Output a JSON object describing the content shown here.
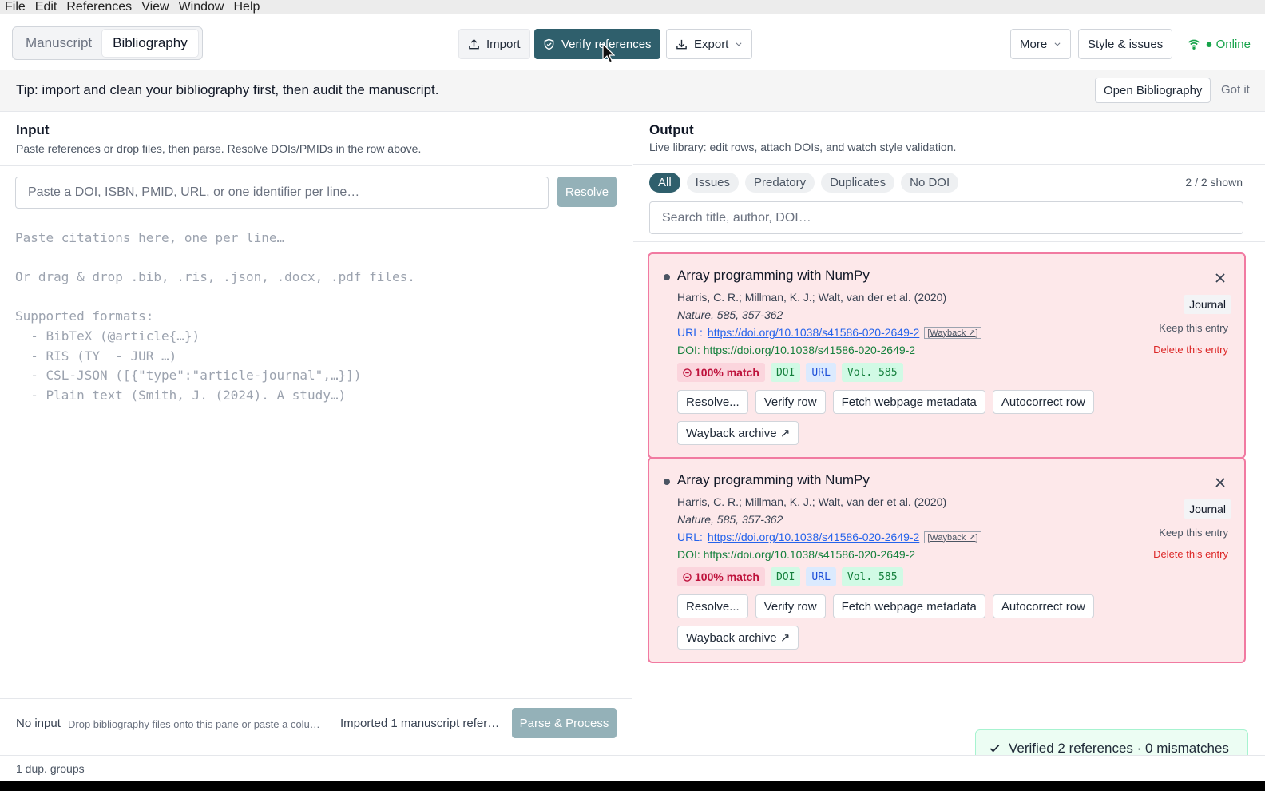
{
  "menubar": [
    "File",
    "Edit",
    "References",
    "View",
    "Window",
    "Help"
  ],
  "toolbar": {
    "tabs": [
      {
        "label": "Manuscript",
        "active": false
      },
      {
        "label": "Bibliography",
        "active": true
      }
    ],
    "import_label": "Import",
    "verify_label": "Verify references",
    "export_label": "Export",
    "more_label": "More",
    "style_label": "Style & issues",
    "online_label": "● Online"
  },
  "tip": {
    "text": "Tip: import and clean your bibliography first, then audit the manuscript.",
    "open_label": "Open Bibliography",
    "dismiss_label": "Got it"
  },
  "input_pane": {
    "title": "Input",
    "subtitle": "Paste references or drop files, then parse. Resolve DOIs/PMIDs in the row above.",
    "resolve_placeholder": "Paste a DOI, ISBN, PMID, URL, or one identifier per line…",
    "resolve_label": "Resolve",
    "textarea_placeholder": "Paste citations here, one per line…\n\nOr drag & drop .bib, .ris, .json, .docx, .pdf files.\n\nSupported formats:\n  - BibTeX (@article{…})\n  - RIS (TY  - JUR …)\n  - CSL-JSON ([{\"type\":\"article-journal\",…}])\n  - Plain text (Smith, J. (2024). A study…)",
    "footer_status": "No input",
    "footer_hint": "Drop bibliography files onto this pane or paste a colu…",
    "footer_imported": "Imported 1 manuscript refer…",
    "parse_label": "Parse & Process"
  },
  "output_pane": {
    "title": "Output",
    "subtitle": "Live library: edit rows, attach DOIs, and watch style validation.",
    "filters": [
      {
        "label": "All",
        "active": true
      },
      {
        "label": "Issues",
        "active": false
      },
      {
        "label": "Predatory",
        "active": false
      },
      {
        "label": "Duplicates",
        "active": false
      },
      {
        "label": "No DOI",
        "active": false
      }
    ],
    "shown_count": "2 / 2 shown",
    "search_placeholder": "Search title, author, DOI…",
    "entries": [
      {
        "title": "Array programming with NumPy",
        "authors": "Harris, C. R.; Millman, K. J.; Walt, van der et al. (2020)",
        "journal": "Nature, 585, 357-362",
        "url_label": "URL:",
        "url": "https://doi.org/10.1038/s41586-020-2649-2",
        "wayback_link": "[Wayback ↗]",
        "doi": "DOI: https://doi.org/10.1038/s41586-020-2649-2",
        "match": "100% match",
        "badge_doi": "DOI",
        "badge_url": "URL",
        "badge_vol": "Vol. 585",
        "type": "Journal",
        "keep_label": "Keep this entry",
        "delete_label": "Delete this entry",
        "actions": [
          "Resolve...",
          "Verify row",
          "Fetch webpage metadata",
          "Autocorrect row",
          "Wayback archive ↗"
        ]
      },
      {
        "title": "Array programming with NumPy",
        "authors": "Harris, C. R.; Millman, K. J.; Walt, van der et al. (2020)",
        "journal": "Nature, 585, 357-362",
        "url_label": "URL:",
        "url": "https://doi.org/10.1038/s41586-020-2649-2",
        "wayback_link": "[Wayback ↗]",
        "doi": "DOI: https://doi.org/10.1038/s41586-020-2649-2",
        "match": "100% match",
        "badge_doi": "DOI",
        "badge_url": "URL",
        "badge_vol": "Vol. 585",
        "type": "Journal",
        "keep_label": "Keep this entry",
        "delete_label": "Delete this entry",
        "actions": [
          "Resolve...",
          "Verify row",
          "Fetch webpage metadata",
          "Autocorrect row",
          "Wayback archive ↗"
        ]
      }
    ]
  },
  "toast": {
    "text": "Verified 2 references · 0 mismatches"
  },
  "statusbar": {
    "text": "1 dup. groups"
  },
  "colors": {
    "primary": "#2f5f6c",
    "primary_disabled": "#94b1b8",
    "error_border": "#f17aa1",
    "error_bg": "#fde8ea",
    "success": "#16a34a"
  }
}
